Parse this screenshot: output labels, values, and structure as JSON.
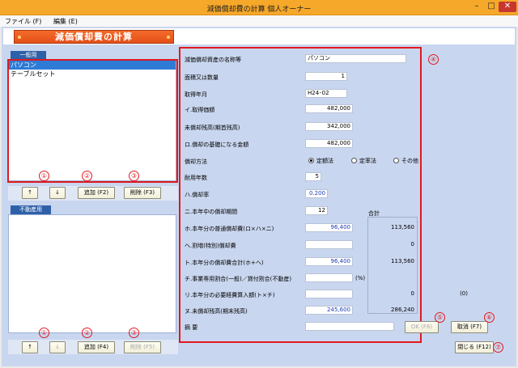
{
  "window": {
    "title": "減価償却費の計算 個人オーナー",
    "minimize": "–",
    "maximize": "□",
    "close": "✕"
  },
  "menu": [
    "ファイル (F)",
    "編集 (E)"
  ],
  "banner": "減価償却費の計算",
  "general": {
    "tab": "一般用",
    "items": [
      "パソコン",
      "テーブルセット"
    ],
    "buttons": {
      "up": "↑",
      "down": "↓",
      "add": "追加 (F2)",
      "delete": "削除 (F3)"
    }
  },
  "realestate": {
    "tab": "不動産用",
    "items": [],
    "buttons": {
      "up": "↑",
      "down": "↓",
      "add": "追加 (F4)",
      "delete": "削除 (F5)"
    }
  },
  "form": {
    "name_label": "減価償却資産の名称等",
    "name_value": "パソコン",
    "qty_label": "面積又は数量",
    "qty_value": "1",
    "date_label": "取得年月",
    "date_value": "H24･02",
    "cost_label": "イ.取得価額",
    "cost_value": "482,000",
    "unamort_label": "未償却残高(期首残高)",
    "unamort_value": "342,000",
    "base_label": "ロ.償却の基礎になる金額",
    "base_value": "482,000",
    "method_label": "償却方法",
    "method_options": [
      "定額法",
      "定率法",
      "その他"
    ],
    "life_label": "耐用年数",
    "life_value": "5",
    "rate_label": "ハ.償却率",
    "rate_value": "0.200",
    "months_label": "ニ.本年中の償却期間",
    "months_value": "12",
    "normal_label": "ホ.本年分の普通償却費(ロ×ハ×ニ)",
    "normal_value": "96,400",
    "extra_label": "ヘ.割増(特別)償却費",
    "extra_value": "",
    "total_label": "ト.本年分の償却費合計(ホ+ヘ)",
    "total_value": "96,400",
    "business_label": "チ.事業専用割合(一般)／貸付割合(不動産)",
    "business_unit": "(%)",
    "expense_label": "リ.本年分の必要経費算入額(ト×チ)",
    "expense_value": "",
    "balance_label": "ヌ.未償却残高(期末残高)",
    "balance_value": "245,600",
    "memo_label": "摘 要",
    "memo_value": ""
  },
  "totals": {
    "label": "合計",
    "normal": "113,560",
    "extra": "0",
    "total": "113,560",
    "expense": "0",
    "balance": "286,240",
    "extra_expense": "(0)"
  },
  "actions": {
    "ok": "OK (F6)",
    "cancel": "取消 (F7)",
    "close": "閉じる (F12)"
  },
  "callouts": [
    "①",
    "②",
    "③",
    "④",
    "⑤",
    "⑥",
    "⑦"
  ]
}
